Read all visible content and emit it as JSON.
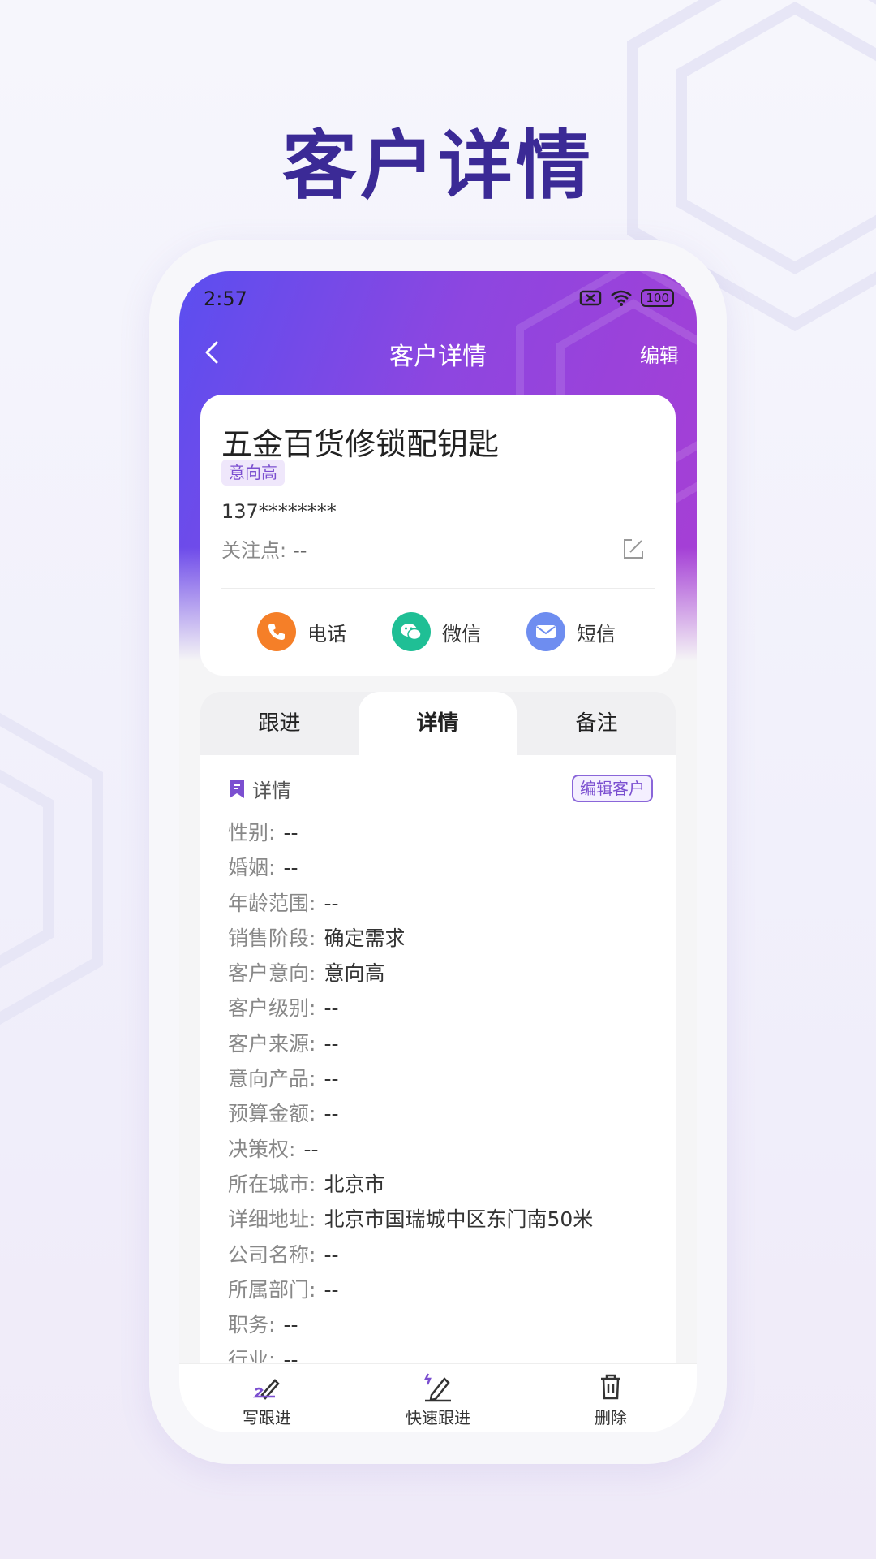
{
  "promo": {
    "title": "客户详情"
  },
  "status": {
    "time": "2:57",
    "battery": "100"
  },
  "nav": {
    "title": "客户详情",
    "edit": "编辑"
  },
  "customer": {
    "name": "五金百货修锁配钥匙",
    "intent_tag": "意向高",
    "phone": "137********",
    "focus_label": "关注点:",
    "focus_value": "--"
  },
  "contacts": [
    {
      "label": "电话",
      "icon": "phone-icon",
      "color": "#f57f28"
    },
    {
      "label": "微信",
      "icon": "wechat-icon",
      "color": "#1fbf95"
    },
    {
      "label": "短信",
      "icon": "sms-icon",
      "color": "#6e8df0"
    }
  ],
  "tabs": [
    "跟进",
    "详情",
    "备注"
  ],
  "active_tab": "详情",
  "detail": {
    "section_title": "详情",
    "edit_button": "编辑客户",
    "fields": [
      {
        "label": "性别:",
        "value": "--"
      },
      {
        "label": "婚姻:",
        "value": "--"
      },
      {
        "label": "年龄范围:",
        "value": "--"
      },
      {
        "label": "销售阶段:",
        "value": "确定需求"
      },
      {
        "label": "客户意向:",
        "value": "意向高"
      },
      {
        "label": "客户级别:",
        "value": "--"
      },
      {
        "label": "客户来源:",
        "value": "--"
      },
      {
        "label": "意向产品:",
        "value": "--"
      },
      {
        "label": "预算金额:",
        "value": "--"
      },
      {
        "label": "决策权:",
        "value": "--"
      },
      {
        "label": "所在城市:",
        "value": "北京市"
      },
      {
        "label": "详细地址:",
        "value": "北京市国瑞城中区东门南50米"
      },
      {
        "label": "公司名称:",
        "value": "--"
      },
      {
        "label": "所属部门:",
        "value": "--"
      },
      {
        "label": "职务:",
        "value": "--"
      },
      {
        "label": "行业:",
        "value": "--"
      }
    ]
  },
  "bottom_bar": [
    {
      "label": "写跟进",
      "icon": "write-followup-icon"
    },
    {
      "label": "快速跟进",
      "icon": "quick-followup-icon"
    },
    {
      "label": "删除",
      "icon": "trash-icon"
    }
  ],
  "colors": {
    "accent": "#7b4fd0",
    "title": "#3b2a96",
    "header_start": "#5b4ef0",
    "header_end": "#a83ed4"
  }
}
